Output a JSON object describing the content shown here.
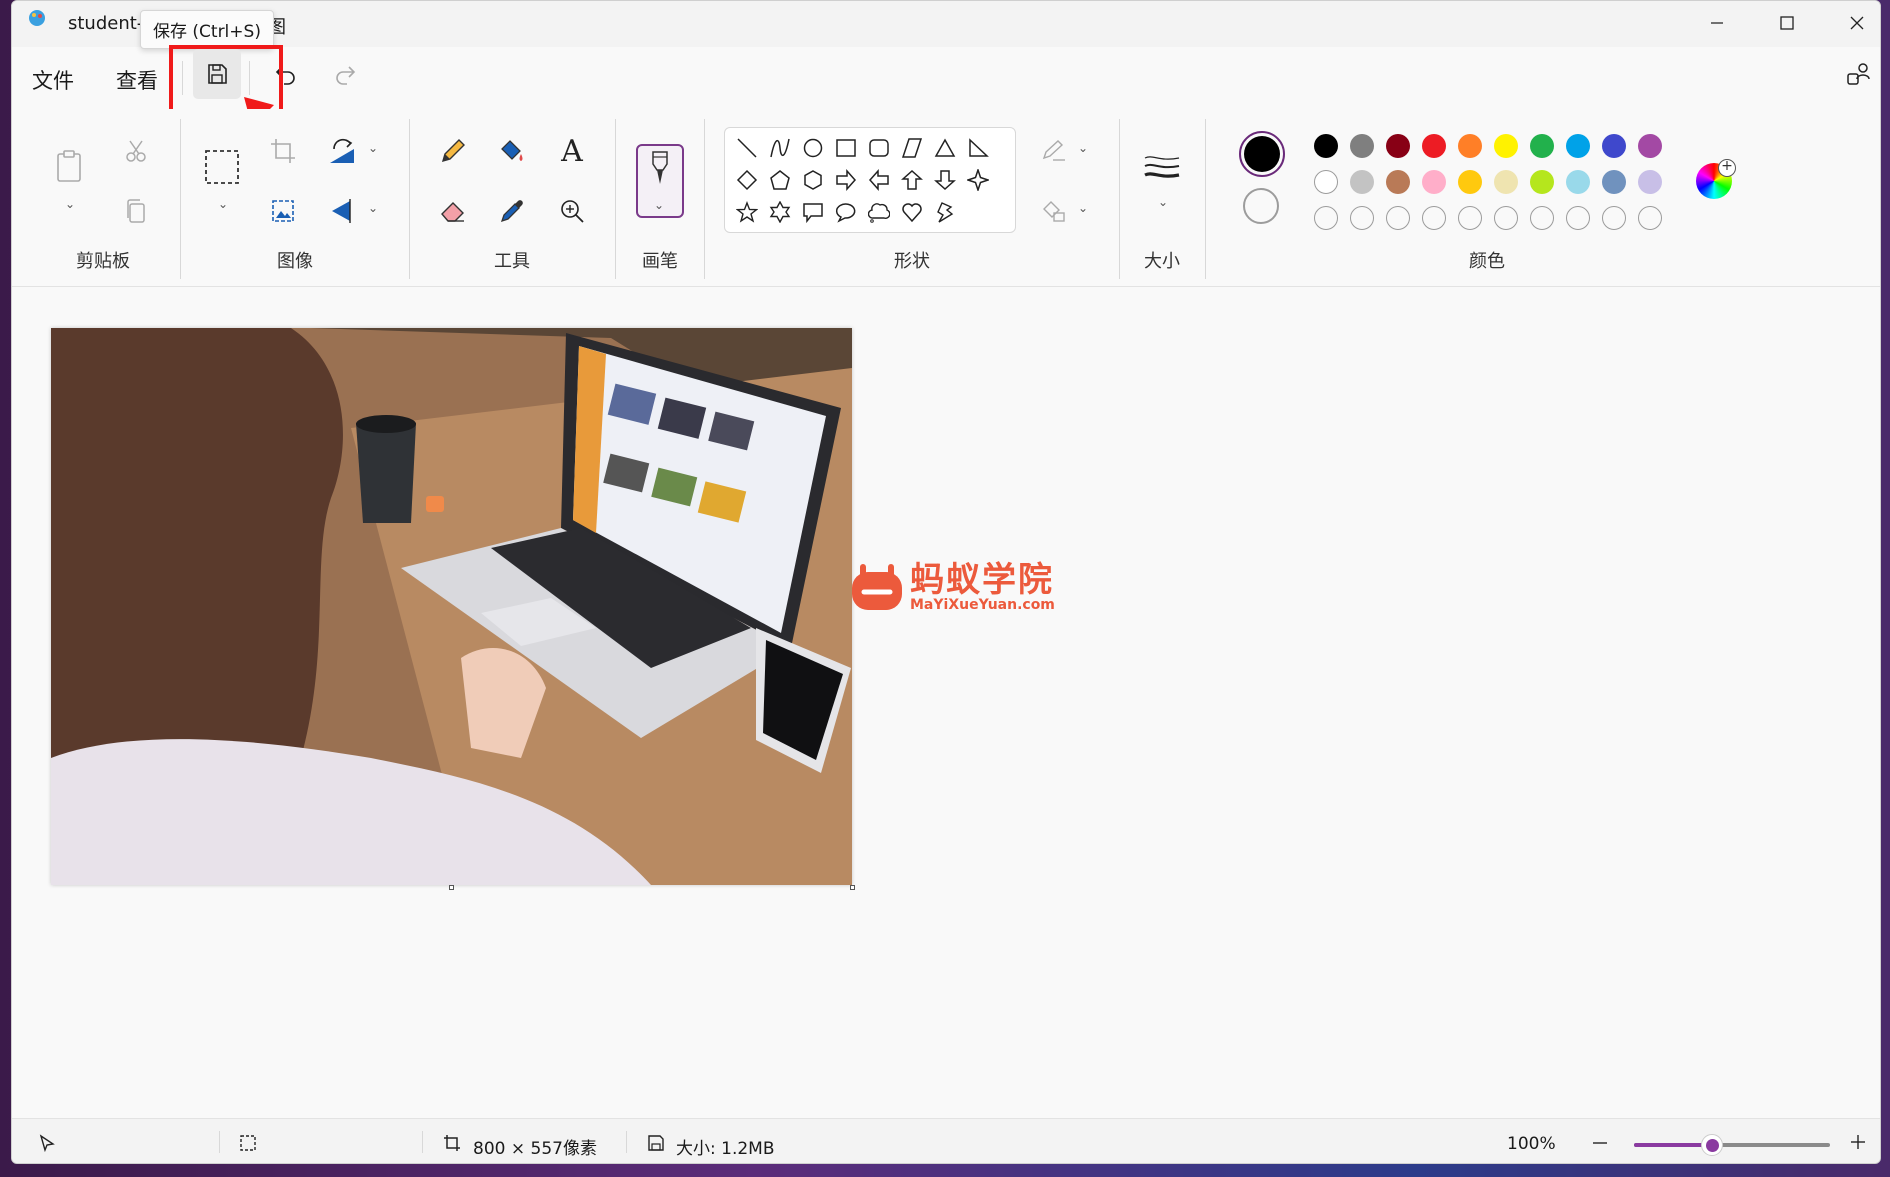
{
  "window": {
    "title": "student-8",
    "title_suffix": "图",
    "tooltip": "保存 (Ctrl+S)"
  },
  "menu": {
    "file": "文件",
    "view": "查看"
  },
  "ribbon": {
    "groups": {
      "clipboard": "剪贴板",
      "image": "图像",
      "tools": "工具",
      "brushes": "画笔",
      "shapes": "形状",
      "size": "大小",
      "colors": "颜色"
    },
    "text_tool_glyph": "A"
  },
  "colors": {
    "accent": "#8a3aa0",
    "highlight_red": "#f01a1a",
    "primary": "#000000",
    "secondary": "#ffffff",
    "palette_row1": [
      "#000000",
      "#7f7f7f",
      "#880015",
      "#ed1c24",
      "#ff7f27",
      "#fff200",
      "#22b14c",
      "#00a2e8",
      "#3f48cc",
      "#a349a4"
    ],
    "palette_row2": [
      "#ffffff",
      "#c3c3c3",
      "#b97a57",
      "#ffaec9",
      "#ffc90e",
      "#efe4b0",
      "#b5e61d",
      "#99d9ea",
      "#7092be",
      "#c8bfe7"
    ],
    "palette_row3_empty_count": 10
  },
  "watermark": {
    "title": "蚂蚁学院",
    "subtitle": "MaYiXueYuan.com"
  },
  "status": {
    "canvas_size": "800 × 557像素",
    "file_size": "大小: 1.2MB",
    "zoom": "100%",
    "zoom_level_percent": 100,
    "zoom_slider_fraction": 0.4
  }
}
